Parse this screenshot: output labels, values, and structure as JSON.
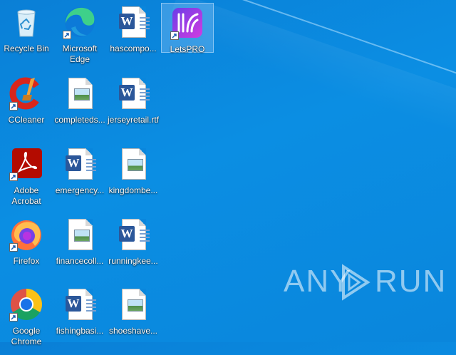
{
  "desktop": {
    "icons": [
      {
        "id": "recycle-bin",
        "label": "Recycle Bin",
        "icon": "recycle-bin-icon",
        "shortcut": false
      },
      {
        "id": "edge",
        "label": "Microsoft Edge",
        "icon": "edge-icon",
        "shortcut": true
      },
      {
        "id": "hascompo",
        "label": "hascompo...",
        "icon": "word-document-icon",
        "shortcut": false
      },
      {
        "id": "letspro",
        "label": "LetsPRO",
        "icon": "letspro-icon",
        "shortcut": true,
        "selected": true
      },
      {
        "id": "ccleaner",
        "label": "CCleaner",
        "icon": "ccleaner-icon",
        "shortcut": true
      },
      {
        "id": "completeds",
        "label": "completeds...",
        "icon": "image-document-icon",
        "shortcut": false
      },
      {
        "id": "jerseyretail",
        "label": "jerseyretail.rtf",
        "icon": "word-document-icon",
        "shortcut": false
      },
      {
        "id": "acrobat",
        "label": "Adobe Acrobat",
        "icon": "acrobat-icon",
        "shortcut": true
      },
      {
        "id": "emergency",
        "label": "emergency...",
        "icon": "word-document-icon",
        "shortcut": false
      },
      {
        "id": "kingdombe",
        "label": "kingdombe...",
        "icon": "image-document-icon",
        "shortcut": false
      },
      {
        "id": "firefox",
        "label": "Firefox",
        "icon": "firefox-icon",
        "shortcut": true
      },
      {
        "id": "financecoll",
        "label": "financecoll...",
        "icon": "image-document-icon",
        "shortcut": false
      },
      {
        "id": "runningkee",
        "label": "runningkee...",
        "icon": "word-document-icon",
        "shortcut": false
      },
      {
        "id": "chrome",
        "label": "Google Chrome",
        "icon": "chrome-icon",
        "shortcut": true
      },
      {
        "id": "fishingbasi",
        "label": "fishingbasi...",
        "icon": "word-document-icon",
        "shortcut": false
      },
      {
        "id": "shoeshave",
        "label": "shoeshave...",
        "icon": "image-document-icon",
        "shortcut": false
      }
    ]
  },
  "watermark": {
    "left": "ANY",
    "right": "RUN"
  },
  "colors": {
    "desktop": "#0a86dc",
    "word": "#2b579a",
    "selection": "#b4d7ff"
  }
}
